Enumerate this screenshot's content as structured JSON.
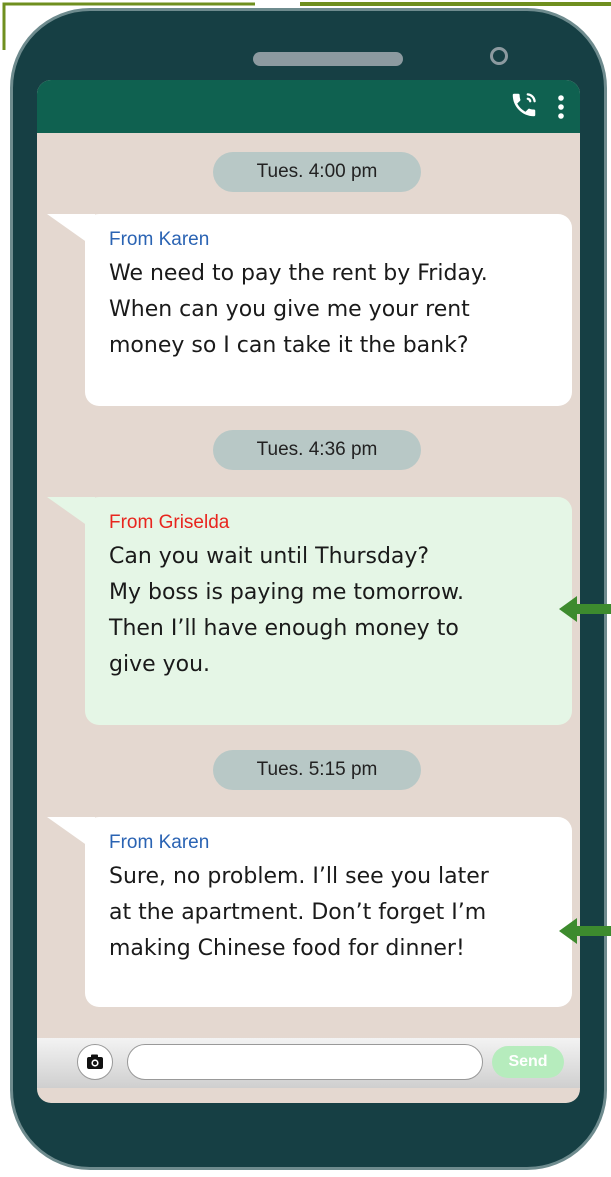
{
  "colors": {
    "phone_body": "#163f44",
    "screen_bg": "#e4d8d0",
    "topbar": "#0f6150",
    "timestamp_bg": "#b8c8c6",
    "karen_bubble": "#ffffff",
    "griselda_bubble": "#e5f6e6",
    "karen_name": "#2a63b3",
    "griselda_name": "#e8251e",
    "send_button": "#b6ecbd",
    "arrow": "#3d8b2e"
  },
  "header": {
    "icons": [
      "phone-call-icon",
      "more-vert-icon"
    ]
  },
  "conversation": [
    {
      "timestamp": "Tues. 4:00 pm",
      "sender": "From Karen",
      "lines": [
        "We need to pay the rent by Friday.",
        "When can you give me your rent",
        "money so I can take it the bank?"
      ]
    },
    {
      "timestamp": "Tues. 4:36 pm",
      "sender": "From Griselda",
      "lines": [
        "Can you wait until Thursday?",
        "My boss is paying me tomorrow.",
        "Then I’ll have enough money to",
        "give you."
      ]
    },
    {
      "timestamp": "Tues. 5:15 pm",
      "sender": "From Karen",
      "lines": [
        "Sure, no problem. I’ll see you later",
        "at the apartment. Don’t forget I’m",
        "making Chinese food for dinner!"
      ]
    }
  ],
  "composer": {
    "camera_icon": "camera-icon",
    "input_value": "",
    "input_placeholder": "",
    "send_label": "Send"
  }
}
